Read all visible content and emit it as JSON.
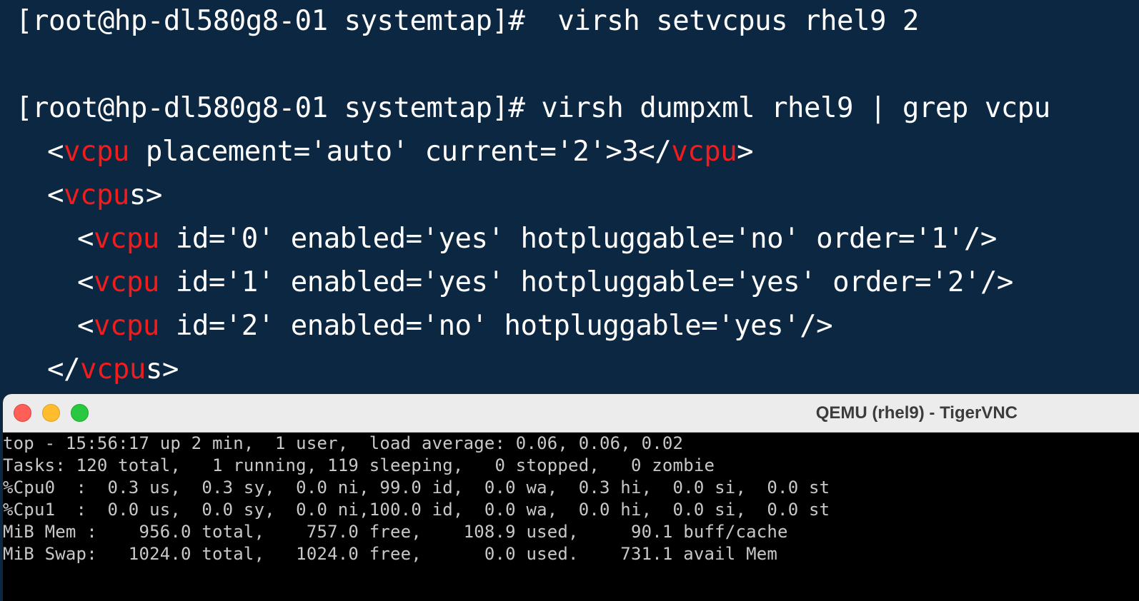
{
  "terminal": {
    "line1": "[root@hp-dl580g8-01 systemtap]#  virsh setvcpus rhel9 2",
    "line2": "[root@hp-dl580g8-01 systemtap]# virsh dumpxml rhel9 | grep vcpu",
    "xml": {
      "vcpu_tag": "vcpu",
      "vcpus_tag_base": "vcpu",
      "line3_attrs": " placement='auto' current='2'>3</",
      "line5_attrs": " id='0' enabled='yes' hotpluggable='no' order='1'/>",
      "line6_attrs": " id='1' enabled='yes' hotpluggable='yes' order='2'/>",
      "line7_attrs": " id='2' enabled='no' hotpluggable='yes'/>"
    }
  },
  "vnc": {
    "title": "QEMU (rhel9) - TigerVNC",
    "top_lines": [
      "top - 15:56:17 up 2 min,  1 user,  load average: 0.06, 0.06, 0.02",
      "Tasks: 120 total,   1 running, 119 sleeping,   0 stopped,   0 zombie",
      "%Cpu0  :  0.3 us,  0.3 sy,  0.0 ni, 99.0 id,  0.0 wa,  0.3 hi,  0.0 si,  0.0 st",
      "%Cpu1  :  0.0 us,  0.0 sy,  0.0 ni,100.0 id,  0.0 wa,  0.0 hi,  0.0 si,  0.0 st",
      "MiB Mem :    956.0 total,    757.0 free,    108.9 used,     90.1 buff/cache",
      "MiB Swap:   1024.0 total,   1024.0 free,      0.0 used.    731.1 avail Mem"
    ]
  },
  "colors": {
    "terminal_bg": "#0b2742",
    "terminal_text": "#ffffff",
    "highlight": "#f21c1c",
    "vnc_bg": "#000000",
    "vnc_text": "#c8c8c8"
  },
  "icons": {
    "close": "close-light-icon",
    "minimize": "minimize-light-icon",
    "maximize": "maximize-light-icon"
  }
}
